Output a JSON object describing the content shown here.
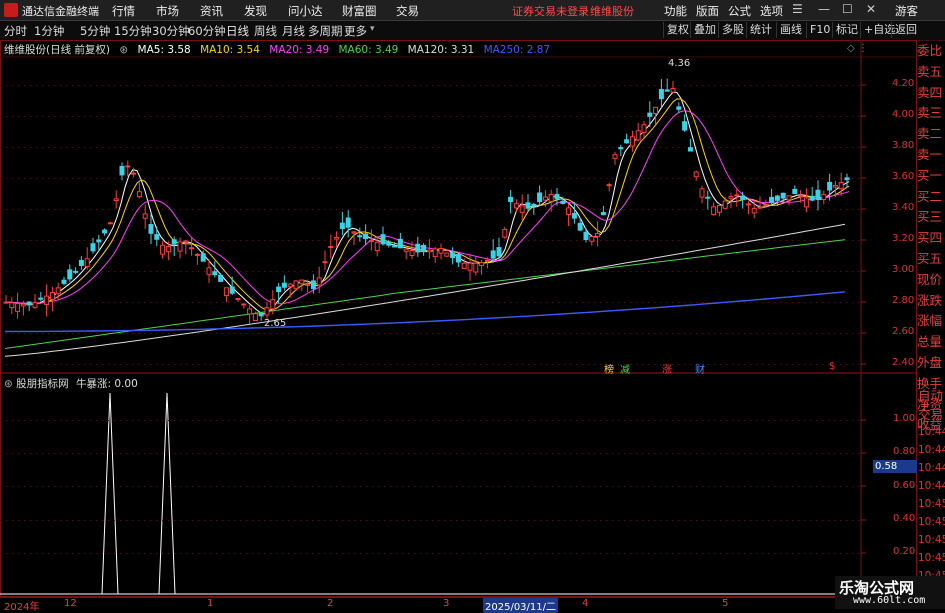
{
  "menubar": {
    "app_title": "通达信金融终端",
    "items": [
      "行情",
      "市场",
      "资讯",
      "发现",
      "问小达",
      "财富圈",
      "交易"
    ],
    "warning": "证券交易未登录",
    "stock_name": "维维股份",
    "right_items": [
      "功能",
      "版面",
      "公式",
      "选项"
    ],
    "user": "游客"
  },
  "toolbar": {
    "periods": [
      "分时",
      "1分钟",
      "5分钟",
      "15分钟",
      "30分钟",
      "60分钟",
      "日线",
      "周线",
      "月线",
      "多周期",
      "更多"
    ],
    "active_period": "日线",
    "buttons": [
      "复权",
      "叠加",
      "多股",
      "统计",
      "画线",
      "F10",
      "标记",
      "+自选",
      "返回"
    ]
  },
  "chart": {
    "title": "维维股份(日线 前复权)",
    "ma": [
      {
        "label": "MA5: 3.58",
        "color": "#ffffff"
      },
      {
        "label": "MA10: 3.54",
        "color": "#ffd400"
      },
      {
        "label": "MA20: 3.49",
        "color": "#ff3cff"
      },
      {
        "label": "MA60: 3.49",
        "color": "#4cd44c"
      },
      {
        "label": "MA120: 3.31",
        "color": "#dddddd"
      },
      {
        "label": "MA250: 2.87",
        "color": "#3a5cff"
      }
    ],
    "high_label": "4.36",
    "low_label": "2.65",
    "y_ticks": [
      "4.20",
      "4.00",
      "3.80",
      "3.60",
      "3.40",
      "3.20",
      "3.00",
      "2.80",
      "2.60",
      "2.40"
    ],
    "events": [
      {
        "text": "榜",
        "color": "#ffd400"
      },
      {
        "text": "减",
        "color": "#4cd44c"
      },
      {
        "text": "涨",
        "color": "#ff3030"
      },
      {
        "text": "财",
        "color": "#3a8cff"
      },
      {
        "text": "$",
        "color": "#ff3030"
      }
    ]
  },
  "indicator": {
    "title": "股朋指标网",
    "value_label": "牛暴涨: 0.00",
    "y_ticks": [
      "1.00",
      "0.80",
      "0.60",
      "0.40",
      "0.20"
    ],
    "marker": "0.58"
  },
  "right_panel": {
    "labels": [
      "委比",
      "卖五",
      "卖四",
      "卖三",
      "卖二",
      "卖一",
      "买一",
      "买二",
      "买三",
      "买四",
      "买五",
      "现价",
      "涨跌",
      "涨幅",
      "总量",
      "外盘",
      "换手",
      "净资",
      "收益"
    ],
    "auto_label": "自动",
    "trade_label": "交易",
    "times": [
      "10:44",
      "10:44",
      "10:44",
      "10:44",
      "10:45",
      "10:45",
      "10:45",
      "10:45",
      "10:45"
    ]
  },
  "xaxis": {
    "labels": [
      "2024年",
      "12",
      "1",
      "2",
      "3",
      "2025/03/11/二",
      "4",
      "5"
    ]
  },
  "watermark": {
    "cn": "乐淘公式网",
    "url": "www.60lt.com"
  }
}
